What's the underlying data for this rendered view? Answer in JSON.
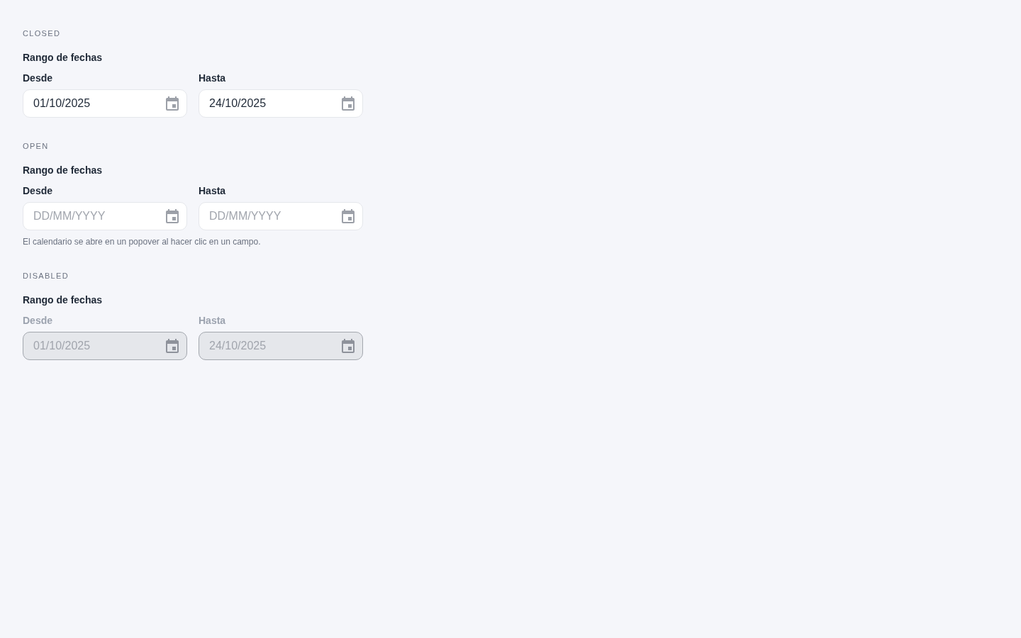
{
  "sections": [
    {
      "heading": "CLOSED",
      "group_label": "Rango de fechas",
      "disabled": false,
      "fields": [
        {
          "label": "Desde",
          "value": "01/10/2025"
        },
        {
          "label": "Hasta",
          "value": "24/10/2025"
        }
      ]
    },
    {
      "heading": "OPEN",
      "group_label": "Rango de fechas",
      "disabled": false,
      "fields": [
        {
          "label": "Desde",
          "placeholder": "DD/MM/YYYY"
        },
        {
          "label": "Hasta",
          "placeholder": "DD/MM/YYYY"
        }
      ],
      "helper": "El calendario se abre en un popover al hacer clic en un campo."
    },
    {
      "heading": "DISABLED",
      "group_label": "Rango de fechas",
      "disabled": true,
      "fields": [
        {
          "label": "Desde",
          "value": "01/10/2025"
        },
        {
          "label": "Hasta",
          "value": "24/10/2025"
        }
      ]
    }
  ]
}
